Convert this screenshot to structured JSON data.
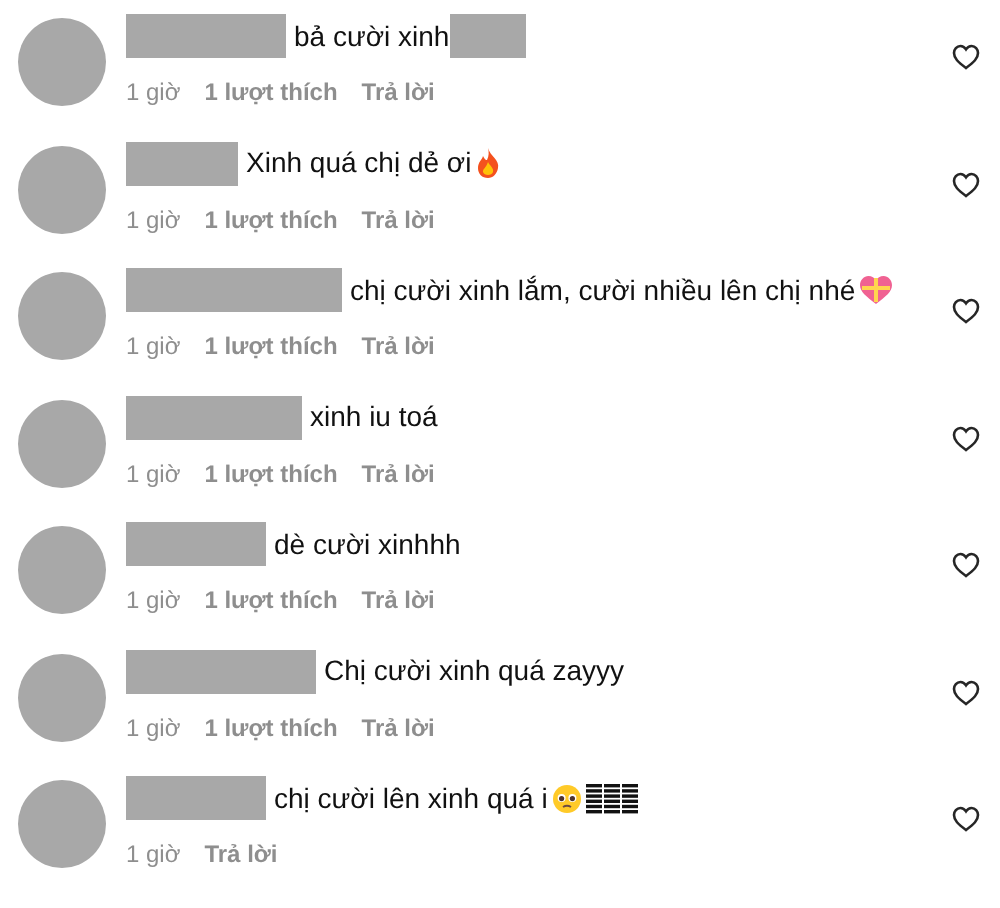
{
  "comments": [
    {
      "text": "bả cười xinh",
      "redacted_after": true,
      "time": "1 giờ",
      "likes": "1 lượt thích",
      "reply": "Trả lời"
    },
    {
      "text": "Xinh quá chị dẻ ơi",
      "redacted_after": false,
      "icons": [
        {
          "kind": "fire"
        }
      ],
      "time": "1 giờ",
      "likes": "1 lượt thích",
      "reply": "Trả lời"
    },
    {
      "text": "chị cười xinh lắm, cười nhiều lên chị nhé",
      "redacted_after": false,
      "icons": [
        {
          "kind": "heart"
        }
      ],
      "time": "1 giờ",
      "likes": "1 lượt thích",
      "reply": "Trả lời"
    },
    {
      "text": "xinh iu toá",
      "redacted_after": false,
      "time": "1 giờ",
      "likes": "1 lượt thích",
      "reply": "Trả lời"
    },
    {
      "text": "dè cười xinhhh",
      "redacted_after": false,
      "time": "1 giờ",
      "likes": "1 lượt thích",
      "reply": "Trả lời"
    },
    {
      "text": "Chị cười xinh quá zayyy",
      "redacted_after": false,
      "time": "1 giờ",
      "likes": "1 lượt thích",
      "reply": "Trả lời"
    },
    {
      "text": "chị cười lên xinh quá i",
      "redacted_after": false,
      "icons": [
        {
          "kind": "pleading"
        },
        {
          "kind": "bars"
        }
      ],
      "time": "1 giờ",
      "reply": "Trả lời"
    }
  ]
}
